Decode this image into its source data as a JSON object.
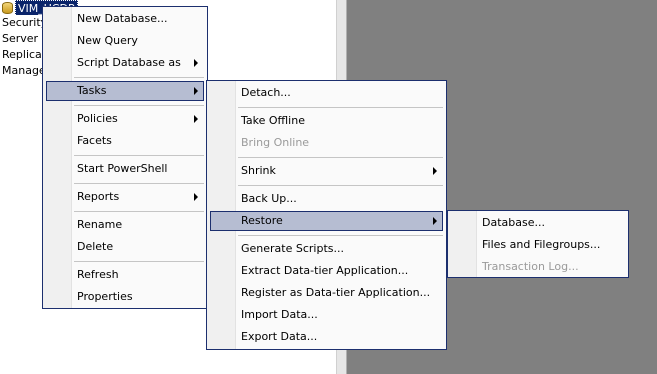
{
  "explorer": {
    "db_label": "VIM_UCDP",
    "tree_items": [
      "Security",
      "Server O",
      "Replicati",
      "Managem"
    ]
  },
  "context_menu": {
    "new_database": "New Database...",
    "new_query": "New Query",
    "script_database_as": "Script Database as",
    "tasks": "Tasks",
    "policies": "Policies",
    "facets": "Facets",
    "start_powershell": "Start PowerShell",
    "reports": "Reports",
    "rename": "Rename",
    "delete": "Delete",
    "refresh": "Refresh",
    "properties": "Properties"
  },
  "tasks_menu": {
    "detach": "Detach...",
    "take_offline": "Take Offline",
    "bring_online": "Bring Online",
    "shrink": "Shrink",
    "back_up": "Back Up...",
    "restore": "Restore",
    "generate_scripts": "Generate Scripts...",
    "extract_dac": "Extract Data-tier Application...",
    "register_dac": "Register as Data-tier Application...",
    "import_data": "Import Data...",
    "export_data": "Export Data..."
  },
  "restore_menu": {
    "database": "Database...",
    "files_filegroups": "Files and Filegroups...",
    "transaction_log": "Transaction Log..."
  },
  "icons": {
    "db_icon": "database-icon",
    "submenu_arrow": "chevron-right-icon"
  }
}
